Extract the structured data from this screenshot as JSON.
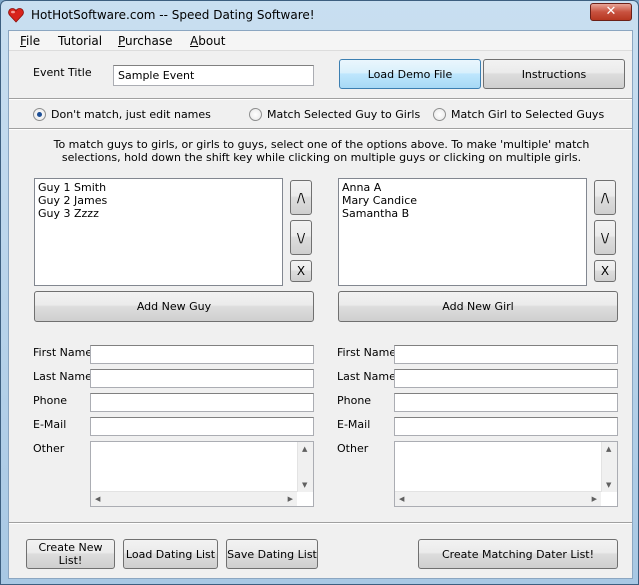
{
  "window": {
    "title": "HotHotSoftware.com -- Speed Dating Software!",
    "close_label": "✕"
  },
  "menu": [
    {
      "label": "File",
      "accel": "F",
      "rest": "ile"
    },
    {
      "label": "Tutorial"
    },
    {
      "label": "Purchase",
      "accel": "P",
      "rest": "urchase"
    },
    {
      "label": "About",
      "accel": "A",
      "rest": "bout"
    }
  ],
  "event": {
    "title_label": "Event Title",
    "title_value": "Sample Event"
  },
  "buttons": {
    "load_demo": "Load Demo File",
    "instructions": "Instructions",
    "add_guy": "Add New Guy",
    "add_girl": "Add New Girl",
    "new_list": "Create New List!",
    "load_list": "Load Dating List",
    "save_list": "Save Dating List",
    "matching_list": "Create Matching Dater List!",
    "move_up": "/\\",
    "move_down": "\\/",
    "remove": "X"
  },
  "modes": [
    {
      "label": "Don't match, just edit names",
      "selected": true
    },
    {
      "label": "Match Selected Guy to Girls",
      "selected": false
    },
    {
      "label": "Match Girl to Selected Guys",
      "selected": false
    }
  ],
  "help_text": "To match guys to girls, or girls to guys, select one of the options above. To make 'multiple' match selections, hold down the shift key while clicking on multiple guys or clicking on multiple girls.",
  "guys": [
    "Guy 1 Smith",
    "Guy 2 James",
    "Guy 3 Zzzz"
  ],
  "girls": [
    "Anna A",
    "Mary Candice",
    "Samantha B"
  ],
  "fields": {
    "first_name": "First Name",
    "last_name": "Last Name",
    "phone": "Phone",
    "email": "E-Mail",
    "other": "Other"
  },
  "colors": {
    "close": "#c8523f",
    "accent": "#3c7fb1"
  }
}
